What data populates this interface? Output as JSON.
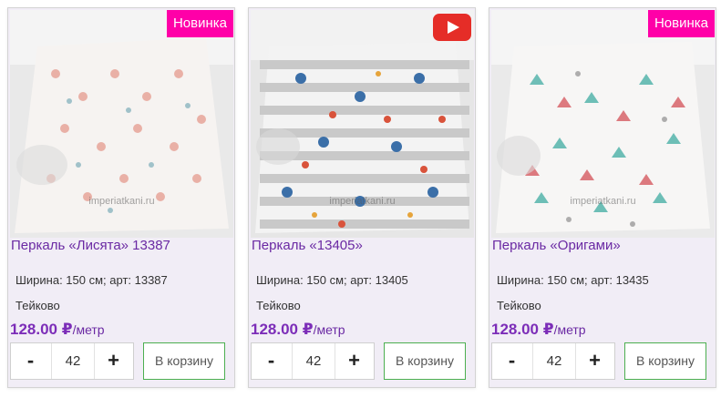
{
  "products": [
    {
      "badge": "Новинка",
      "watermark": "imperiatkani.ru",
      "title": "Перкаль «Лисята» 13387",
      "specs": "Ширина: 150 см; арт: 13387",
      "factory": "Тейково",
      "price": "128.00 ₽",
      "unit": "/метр",
      "qty_minus": "-",
      "qty_value": "42",
      "qty_plus": "+",
      "cart_label": "В корзину"
    },
    {
      "badge_icon": "youtube-play-icon",
      "watermark": "imperiatkani.ru",
      "title": "Перкаль «13405»",
      "specs": "Ширина: 150 см; арт: 13405",
      "factory": "Тейково",
      "price": "128.00 ₽",
      "unit": "/метр",
      "qty_minus": "-",
      "qty_value": "42",
      "qty_plus": "+",
      "cart_label": "В корзину"
    },
    {
      "badge": "Новинка",
      "watermark": "imperiatkani.ru",
      "title": "Перкаль «Оригами»",
      "specs": "Ширина: 150 см; арт: 13435",
      "factory": "Тейково",
      "price": "128.00 ₽",
      "unit": "/метр",
      "qty_minus": "-",
      "qty_value": "42",
      "qty_plus": "+",
      "cart_label": "В корзину"
    }
  ],
  "colors": {
    "card_bg": "#f1edf6",
    "badge_bg": "#ff00a8",
    "title": "#6a29a3",
    "price": "#7c2db8",
    "cart_border": "#4caf50",
    "youtube": "#e52d27"
  }
}
